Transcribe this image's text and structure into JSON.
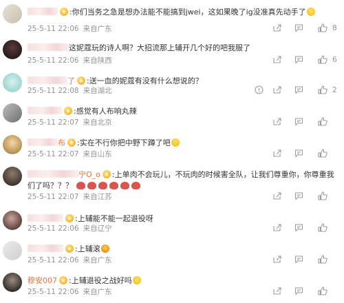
{
  "comments": [
    {
      "username_visible": "",
      "text": ":你们当务之急是想办法能不能搞到jwei，这如果晚了ig没准真先动手了",
      "time": "25-5-11 22:06",
      "location": "来自广东",
      "likes": "8",
      "report": false
    },
    {
      "username_visible": "",
      "text": "这妮蔻玩的诗人啊？大招流那上辅开几个好的吧我服了",
      "time": "25-5-11 22:06",
      "location": "来自陕西",
      "likes": "6",
      "report": false
    },
    {
      "username_visible": "了",
      "text": ":送一血的妮蔻有没有什么想说的？",
      "time": "25-5-11 22:08",
      "location": "来自湖北",
      "likes": "2",
      "report": true
    },
    {
      "username_visible": "",
      "text": ":感觉有人布响丸辣",
      "time": "25-5-11 22:07",
      "location": "来自北京",
      "likes": "",
      "report": false
    },
    {
      "username_visible": "布",
      "text": ":实在不行你把中野下蹲了吧",
      "time": "25-5-11 22:07",
      "location": "来自山东",
      "likes": "",
      "report": false
    },
    {
      "username_visible": "宁O_o",
      "text": ":上单肉不会玩儿，不玩肉的时候害全队，让我们尊重你，你尊重我们了吗？？？",
      "time": "25-5-11 22:07",
      "location": "来自江苏",
      "likes": "",
      "report": false
    },
    {
      "username_visible": "",
      "text": ":上辅能不能一起退役呀",
      "time": "25-5-11 22:06",
      "location": "来自辽宁",
      "likes": "",
      "report": false
    },
    {
      "username_visible": "",
      "text": ":上辅滚",
      "time": "25-5-11 22:06",
      "location": "来自广东",
      "likes": "",
      "report": false
    },
    {
      "username_visible": "穆安007",
      "text": ":上辅退役之战好吗",
      "time": "25-5-11 22:06",
      "location": "来自广东",
      "likes": "",
      "report": false
    }
  ],
  "icons": {
    "share": "share-icon",
    "reply": "reply-icon",
    "like": "thumbs-up-icon",
    "report": "report-icon",
    "verified_badge": "star-badge-icon",
    "emoji": "emoji-icon"
  },
  "colors": {
    "username": "#eb7340",
    "meta": "#939393",
    "text": "#333333"
  }
}
